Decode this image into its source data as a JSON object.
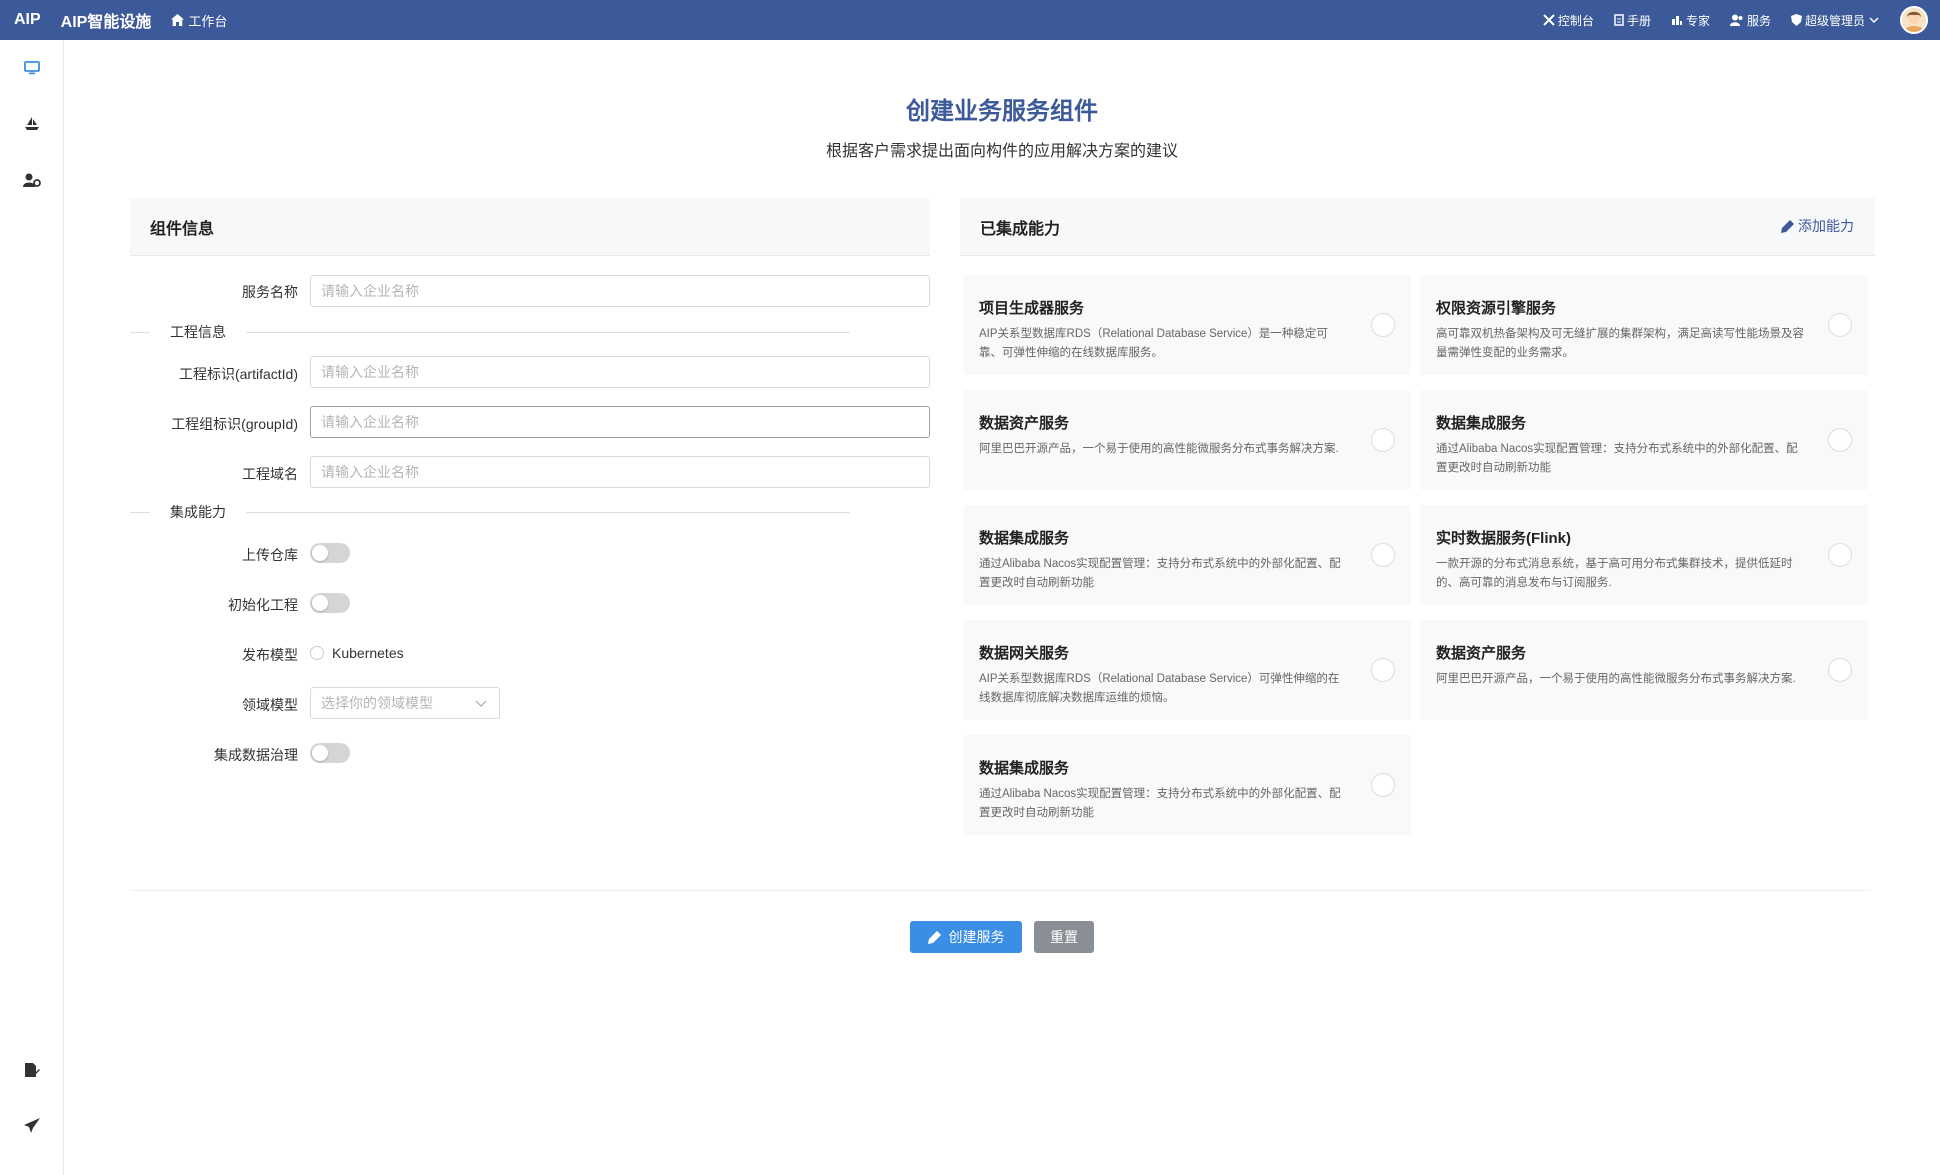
{
  "header": {
    "brand": "AIP",
    "app_title": "AIP智能设施",
    "workbench": "工作台",
    "nav": {
      "console": "控制台",
      "manual": "手册",
      "expert": "专家",
      "service": "服务",
      "admin": "超级管理员"
    },
    "bg_color": "#3c5a9a"
  },
  "page": {
    "title": "创建业务服务组件",
    "subtitle": "根据客户需求提出面向构件的应用解决方案的建议"
  },
  "left_panel": {
    "header": "组件信息",
    "service_name_label": "服务名称",
    "service_name_placeholder": "请输入企业名称",
    "section_project": "工程信息",
    "artifact_label": "工程标识(artifactId)",
    "artifact_placeholder": "请输入企业名称",
    "group_label": "工程组标识(groupId)",
    "group_placeholder": "请输入企业名称",
    "domain_label": "工程域名",
    "domain_placeholder": "请输入企业名称",
    "section_integration": "集成能力",
    "upload_repo_label": "上传仓库",
    "init_project_label": "初始化工程",
    "publish_model_label": "发布模型",
    "publish_model_option": "Kubernetes",
    "domain_model_label": "领域模型",
    "domain_model_placeholder": "选择你的领域模型",
    "data_governance_label": "集成数据治理"
  },
  "right_panel": {
    "header": "已集成能力",
    "add_label": "添加能力",
    "cards": [
      {
        "title": "项目生成器服务",
        "desc": "AIP关系型数据库RDS（Relational Database Service）是一种稳定可靠、可弹性伸缩的在线数据库服务。"
      },
      {
        "title": "权限资源引擎服务",
        "desc": "高可靠双机热备架构及可无缝扩展的集群架构，满足高读写性能场景及容量需弹性变配的业务需求。"
      },
      {
        "title": "数据资产服务",
        "desc": "阿里巴巴开源产品，一个易于使用的高性能微服务分布式事务解决方案."
      },
      {
        "title": "数据集成服务",
        "desc": "通过Alibaba Nacos实现配置管理：支持分布式系统中的外部化配置、配置更改时自动刷新功能"
      },
      {
        "title": "数据集成服务",
        "desc": "通过Alibaba Nacos实现配置管理：支持分布式系统中的外部化配置、配置更改时自动刷新功能"
      },
      {
        "title": "实时数据服务(Flink)",
        "desc": "一款开源的分布式消息系统，基于高可用分布式集群技术，提供低延时的、高可靠的消息发布与订阅服务."
      },
      {
        "title": "数据网关服务",
        "desc": "AIP关系型数据库RDS（Relational Database Service）可弹性伸缩的在线数据库彻底解决数据库运维的烦恼。"
      },
      {
        "title": "数据资产服务",
        "desc": "阿里巴巴开源产品，一个易于使用的高性能微服务分布式事务解决方案."
      },
      {
        "title": "数据集成服务",
        "desc": "通过Alibaba Nacos实现配置管理：支持分布式系统中的外部化配置、配置更改时自动刷新功能"
      }
    ]
  },
  "actions": {
    "create": "创建服务",
    "reset": "重置"
  }
}
